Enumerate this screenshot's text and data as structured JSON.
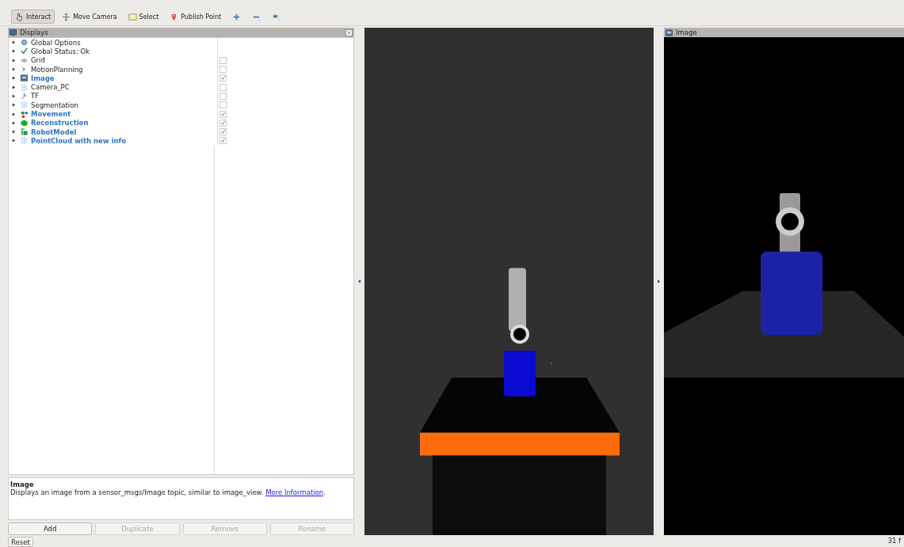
{
  "toolbar": {
    "tools": [
      {
        "label": "Interact",
        "selected": true
      },
      {
        "label": "Move Camera",
        "selected": false
      },
      {
        "label": "Select",
        "selected": false
      },
      {
        "label": "Publish Point",
        "selected": false
      },
      {
        "selected": false
      },
      {
        "selected": false
      },
      {
        "selected": false
      }
    ]
  },
  "displays_panel": {
    "title": "Displays",
    "items": [
      {
        "name": "Global Options",
        "kind": "global"
      },
      {
        "name": "Global Status: Ok",
        "kind": "global"
      },
      {
        "name": "Grid",
        "kind": "display",
        "checked": false
      },
      {
        "name": "MotionPlanning",
        "kind": "display",
        "checked": false
      },
      {
        "name": "Image",
        "kind": "display",
        "checked": true
      },
      {
        "name": "Camera_PC",
        "kind": "display",
        "checked": false
      },
      {
        "name": "TF",
        "kind": "display",
        "checked": false
      },
      {
        "name": "Segmentation",
        "kind": "display",
        "checked": false
      },
      {
        "name": "Movement",
        "kind": "display",
        "checked": true
      },
      {
        "name": "Reconstruction",
        "kind": "display",
        "checked": true
      },
      {
        "name": "RobotModel",
        "kind": "display",
        "checked": true
      },
      {
        "name": "PointCloud with new info",
        "kind": "display",
        "checked": true
      }
    ],
    "description": {
      "title": "Image",
      "text": "Displays an image from a sensor_msgs/Image topic, similar to image_view.",
      "link": "More Information",
      "after": "."
    },
    "buttons": [
      {
        "label": "Add",
        "disabled": false
      },
      {
        "label": "Duplicate",
        "disabled": true
      },
      {
        "label": "Remove",
        "disabled": true
      },
      {
        "label": "Rename",
        "disabled": true
      }
    ]
  },
  "image_panel": {
    "title": "Image"
  },
  "status_bar": {
    "reset": "Reset",
    "fps": "31 f"
  }
}
